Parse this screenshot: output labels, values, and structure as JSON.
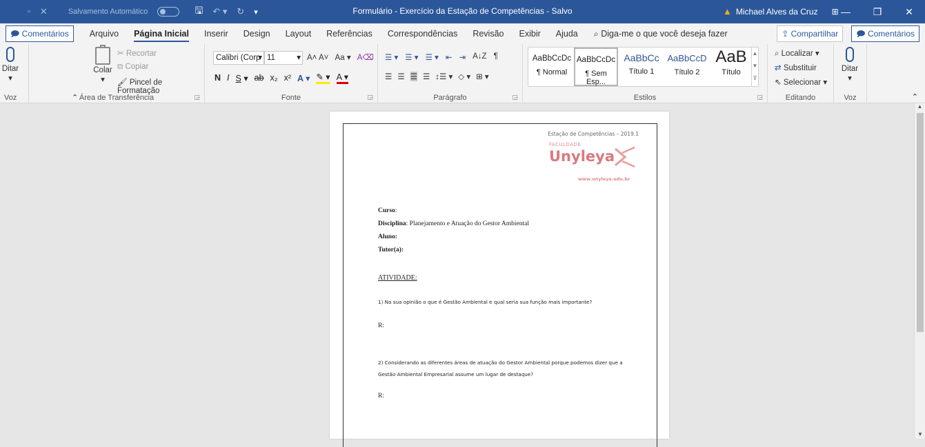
{
  "titlebar": {
    "autosave_label": "Salvamento Automático",
    "doc_title": "Formulário  - Exercício da Estação de Competências  - Salvo",
    "user_name": "Michael Alves da Cruz"
  },
  "tabs": {
    "comments_left": "Comentários",
    "items": [
      "Arquivo",
      "Página Inicial",
      "Inserir",
      "Design",
      "Layout",
      "Referências",
      "Correspondências",
      "Revisão",
      "Exibir",
      "Ajuda"
    ],
    "search_placeholder": "Diga-me o que você deseja fazer",
    "share": "Compartilhar",
    "comments_right": "Comentários"
  },
  "ribbon": {
    "voice_left": {
      "label": "Ditar",
      "group": "Voz"
    },
    "clipboard": {
      "paste": "Colar",
      "cut": "Recortar",
      "copy": "Copiar",
      "format_painter": "Pincel de Formatação",
      "group": "Área de Transferência"
    },
    "font": {
      "family": "Calibri (Corp",
      "size": "11",
      "change_case": "Aa",
      "bold": "N",
      "italic": "I",
      "underline": "S",
      "strike": "ab",
      "group": "Fonte"
    },
    "paragraph": {
      "sort": "A↓Z",
      "pilcrow": "¶",
      "group": "Parágrafo"
    },
    "styles": {
      "items": [
        {
          "sample": "AaBbCcDc",
          "name": "¶ Normal"
        },
        {
          "sample": "AaBbCcDc",
          "name": "¶ Sem Esp..."
        },
        {
          "sample": "AaBbCc",
          "name": "Título 1"
        },
        {
          "sample": "AaBbCcD",
          "name": "Título 2"
        },
        {
          "sample": "AaB",
          "name": "Título"
        }
      ],
      "group": "Estilos"
    },
    "editing": {
      "find": "Localizar",
      "replace": "Substituir",
      "select": "Selecionar",
      "group": "Editando"
    },
    "voice_right": {
      "label": "Ditar",
      "group": "Voz"
    }
  },
  "document": {
    "header_note": "Estação de Competências – 2019.1",
    "logo_small": "FACULDADE",
    "logo_name": "Unyleya",
    "logo_url": "www.unyleya.edu.br",
    "fields": [
      {
        "label": "Curso",
        "value": ":"
      },
      {
        "label": "Disciplina",
        "value": ": Planejamento e Atuação do Gestor Ambiental"
      },
      {
        "label": "Aluno:",
        "value": ""
      },
      {
        "label": "Tutor(a):",
        "value": ""
      }
    ],
    "activity_heading": "ATIVIDADE:",
    "q1": "1) Na sua opinião o que é Gestão Ambiental e qual seria sua função mais importante?",
    "r1": "R:",
    "q2_line1": "2) Considerando as diferentes áreas de atuação do Gestor Ambiental porque podemos dizer que a",
    "q2_line2": "Gestão Ambiental Empresarial assume um lugar de destaque?",
    "r2": "R:"
  },
  "colors": {
    "word_blue": "#2b579a",
    "logo_red": "#c9252c"
  }
}
